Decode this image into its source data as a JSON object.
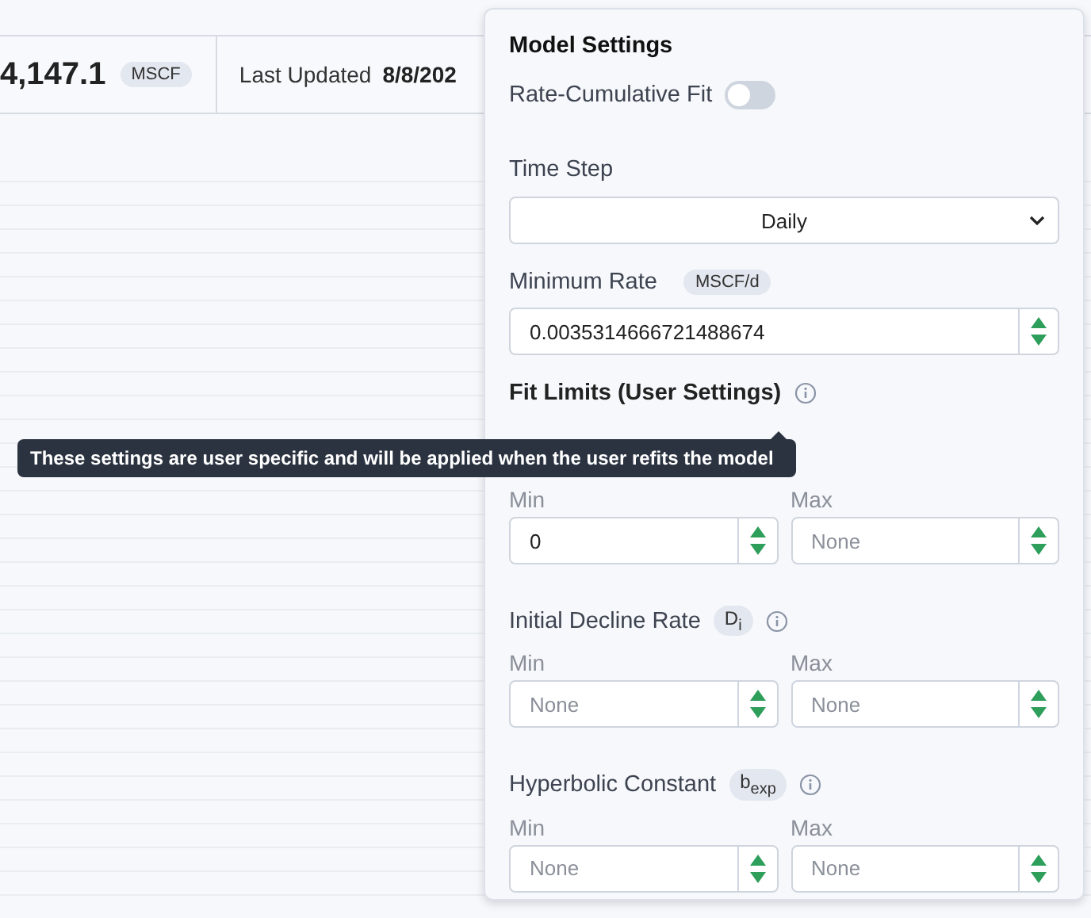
{
  "summary": {
    "value": "4,147.1",
    "unit": "MSCF",
    "updated_label": "Last Updated",
    "updated_value": "8/8/202"
  },
  "panel": {
    "title": "Model Settings",
    "toggle": {
      "label": "Rate-Cumulative Fit",
      "on": false
    },
    "time_step": {
      "label": "Time Step",
      "value": "Daily"
    },
    "minimum_rate": {
      "label": "Minimum Rate",
      "unit": "MSCF/d",
      "value": "0.0035314666721488674"
    },
    "fit_limits": {
      "title": "Fit Limits (User Settings)",
      "tooltip": "These settings are user specific and will be applied when the user refits the model",
      "groups": [
        {
          "min": {
            "label": "Min",
            "value": "0"
          },
          "max": {
            "label": "Max",
            "placeholder": "None"
          }
        },
        {
          "label": "Initial Decline Rate",
          "symbol": "D$_{i}$",
          "min": {
            "label": "Min",
            "placeholder": "None"
          },
          "max": {
            "label": "Max",
            "placeholder": "None"
          }
        },
        {
          "label": "Hyperbolic Constant",
          "symbol": "b$_{exp}$",
          "min": {
            "label": "Min",
            "placeholder": "None"
          },
          "max": {
            "label": "Max",
            "placeholder": "None"
          }
        }
      ]
    }
  }
}
